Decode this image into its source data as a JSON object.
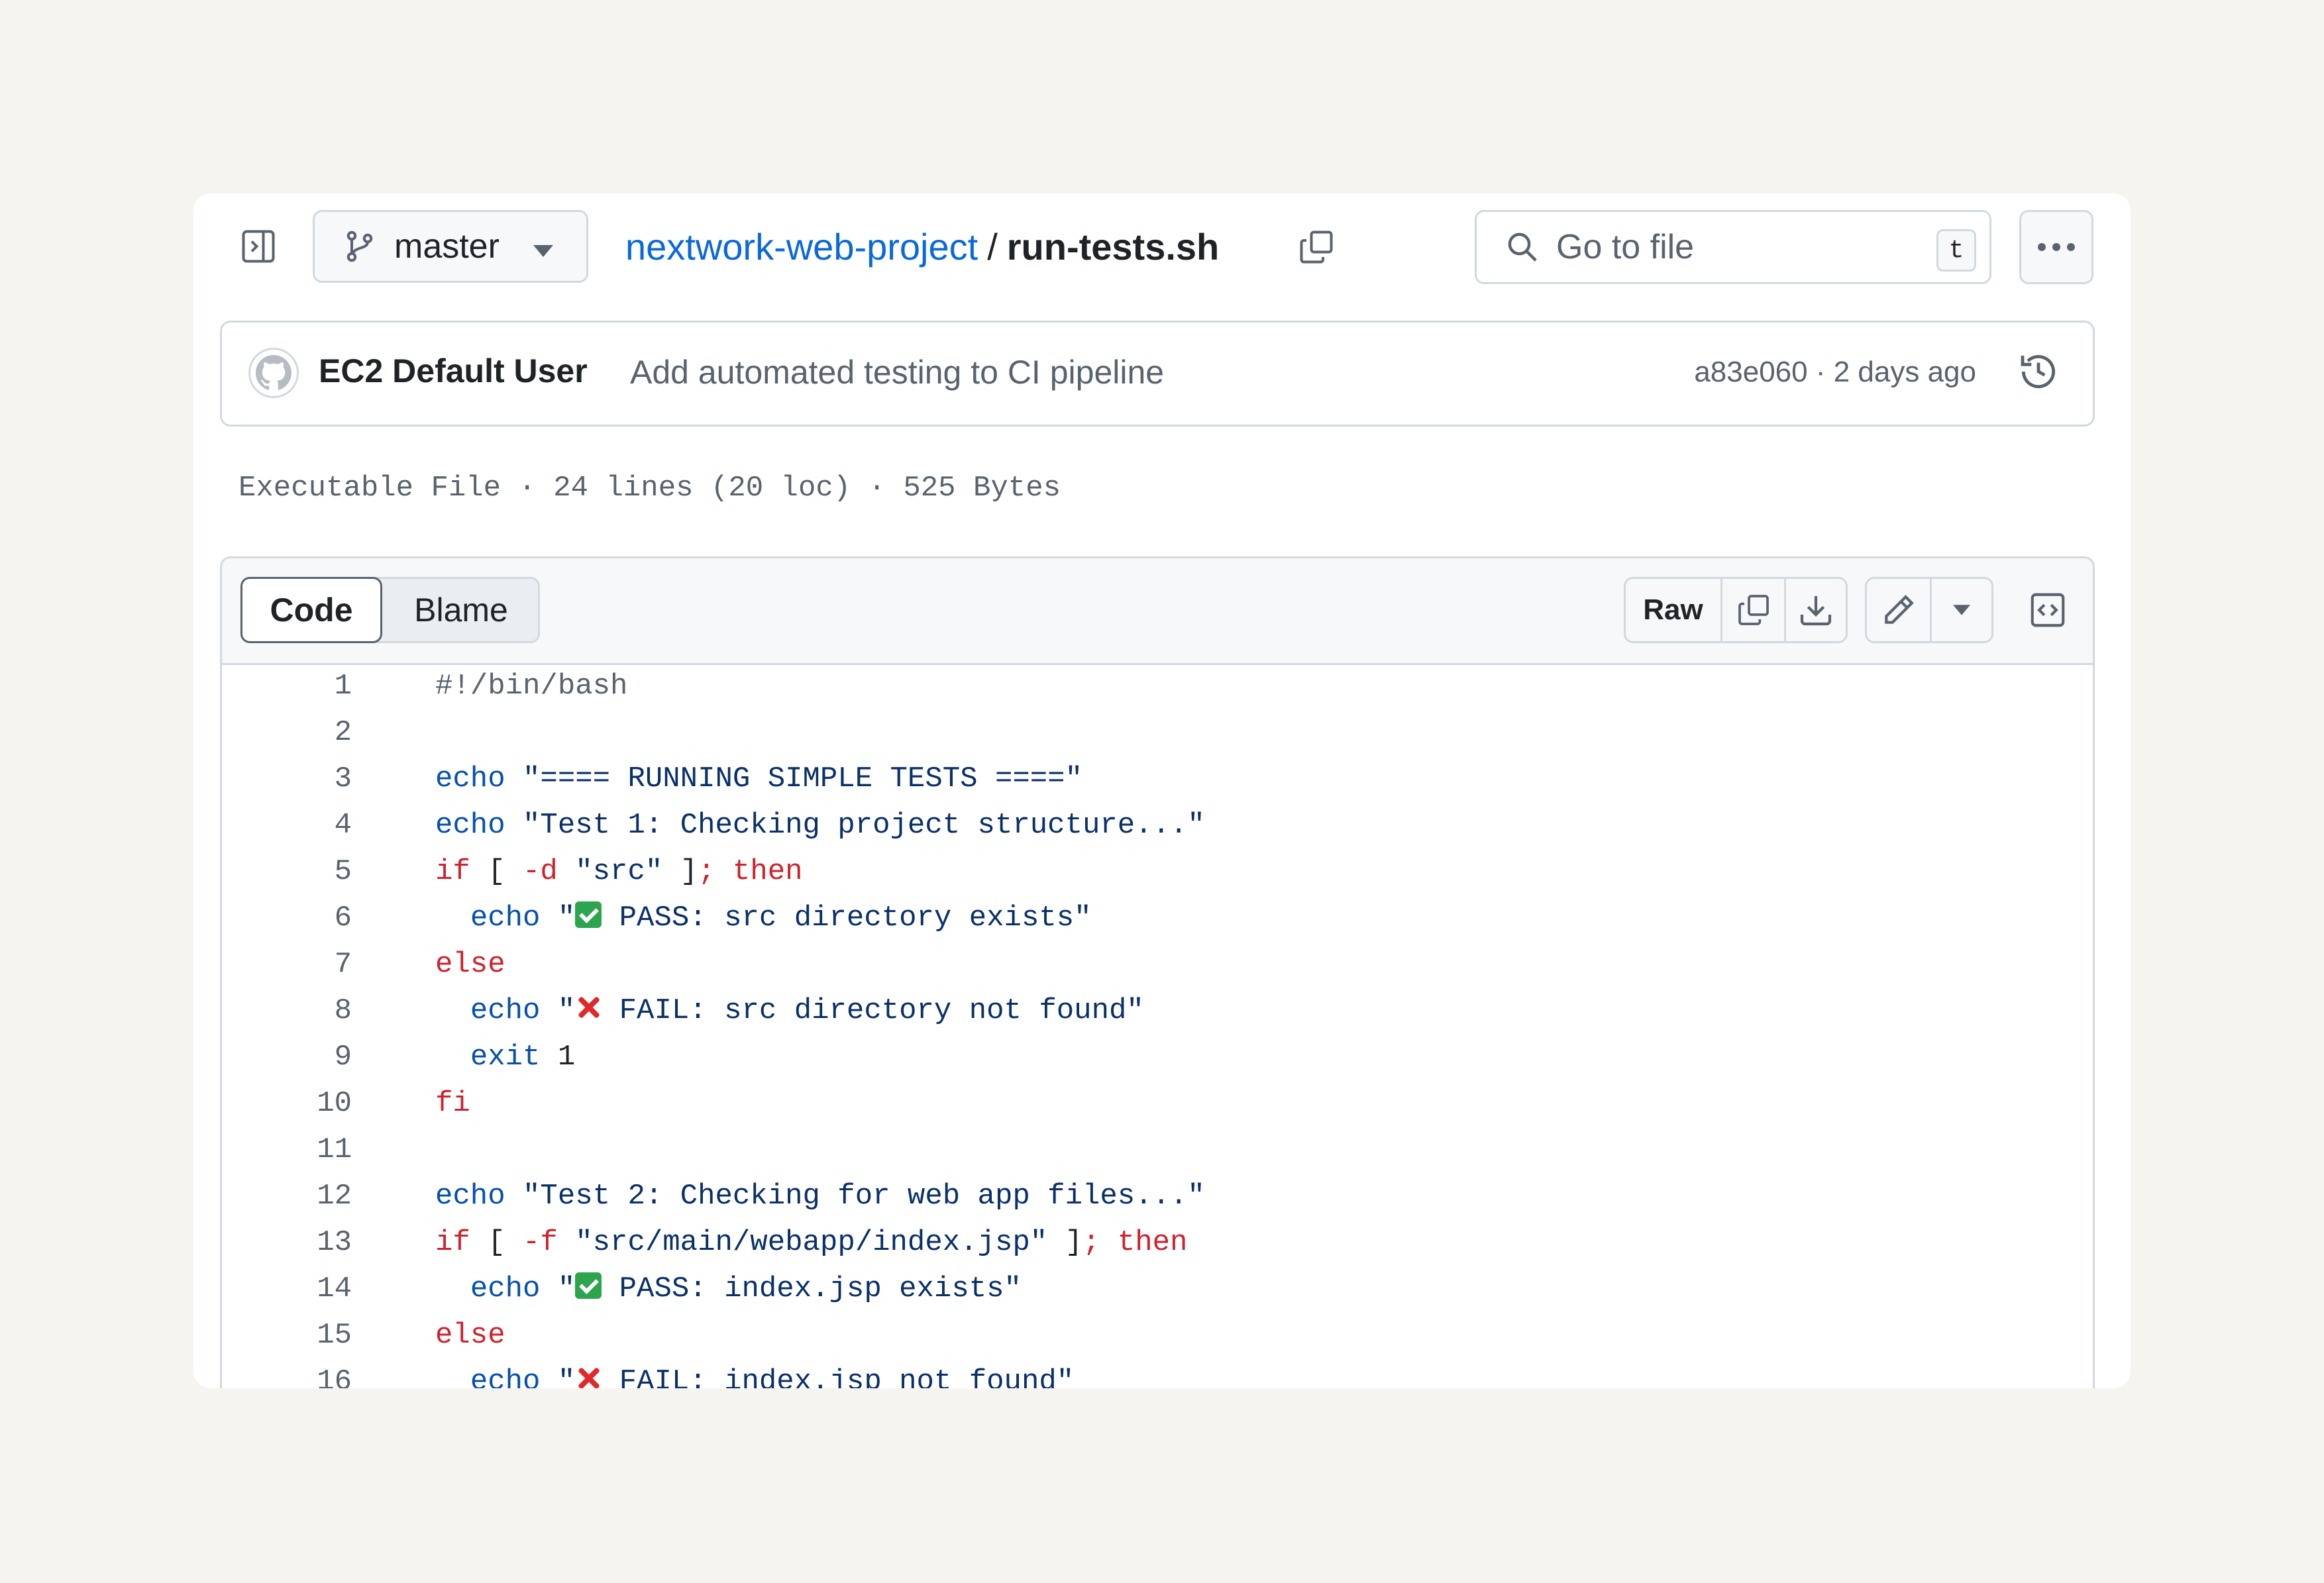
{
  "header": {
    "sidebar_toggle_icon": "sidebar-expand-icon",
    "branch": "master",
    "repo": "nextwork-web-project",
    "separator": "/",
    "file": "run-tests.sh",
    "search_placeholder": "Go to file",
    "search_shortcut": "t"
  },
  "commit": {
    "author": "EC2 Default User",
    "message": "Add automated testing to CI pipeline",
    "meta": "a83e060 · 2 days ago"
  },
  "file_info": "Executable File · 24 lines (20 loc) · 525 Bytes",
  "toolbar": {
    "tab_code": "Code",
    "tab_blame": "Blame",
    "raw": "Raw"
  },
  "code_lines": [
    {
      "n": "1"
    },
    {
      "n": "2"
    },
    {
      "n": "3"
    },
    {
      "n": "4"
    },
    {
      "n": "5"
    },
    {
      "n": "6"
    },
    {
      "n": "7"
    },
    {
      "n": "8"
    },
    {
      "n": "9"
    },
    {
      "n": "10"
    },
    {
      "n": "11"
    },
    {
      "n": "12"
    },
    {
      "n": "13"
    },
    {
      "n": "14"
    },
    {
      "n": "15"
    },
    {
      "n": "16"
    }
  ],
  "code": {
    "l1": "#!/bin/bash",
    "echo": "echo",
    "l3_str": "\"==== RUNNING SIMPLE TESTS ====\"",
    "l4_str": "\"Test 1: Checking project structure...\"",
    "if": "if",
    "bracket_open": "[",
    "l5_flag": "-d",
    "l5_str": "\"src\"",
    "bracket_close": "]",
    "semi_then": "; then",
    "quote": "\"",
    "l6_rest": " PASS: src directory exists\"",
    "else": "else",
    "l8_rest": " FAIL: src directory not found\"",
    "exit": "exit",
    "exit_code": "1",
    "fi": "fi",
    "l12_str": "\"Test 2: Checking for web app files...\"",
    "l13_flag": "-f",
    "l13_str": "\"src/main/webapp/index.jsp\"",
    "l14_rest": " PASS: index.jsp exists\"",
    "l16_rest": " FAIL: index.jsp not found\""
  }
}
